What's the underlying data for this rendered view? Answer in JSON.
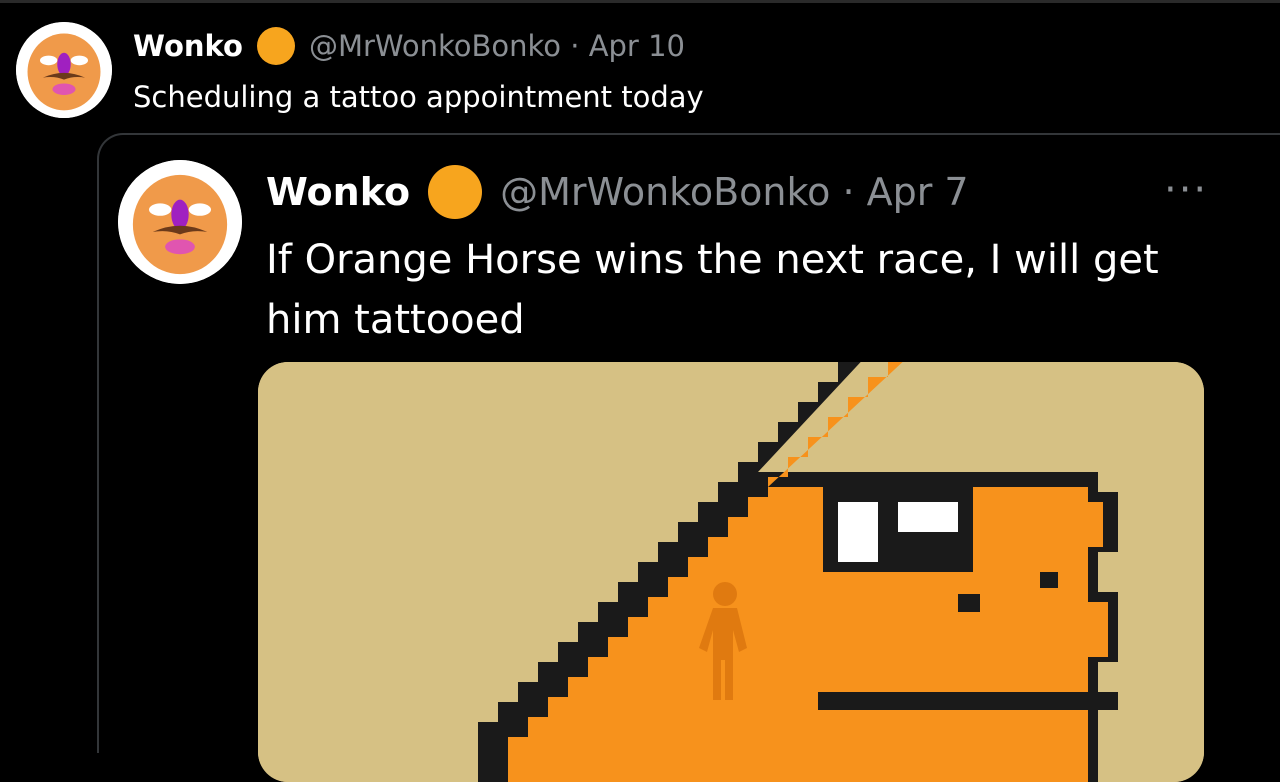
{
  "outer_tweet": {
    "author": "Wonko",
    "handle_date": "@MrWonkoBonko · Apr 10",
    "text": "Scheduling a tattoo appointment today",
    "avatar_icon": "clown-face-avatar-icon",
    "badge_color": "#f7a51e"
  },
  "quoted_tweet": {
    "author": "Wonko",
    "handle_date": "@MrWonkoBonko · Apr 7",
    "text": "If Orange Horse wins the next race, I will get him tattooed",
    "more_label": "···",
    "avatar_icon": "clown-face-avatar-icon",
    "badge_color": "#f7a51e",
    "media": {
      "description_icon": "pixel-dinosaur-image",
      "background_color": "#d6c184",
      "figure_color": "#f7921c"
    }
  }
}
